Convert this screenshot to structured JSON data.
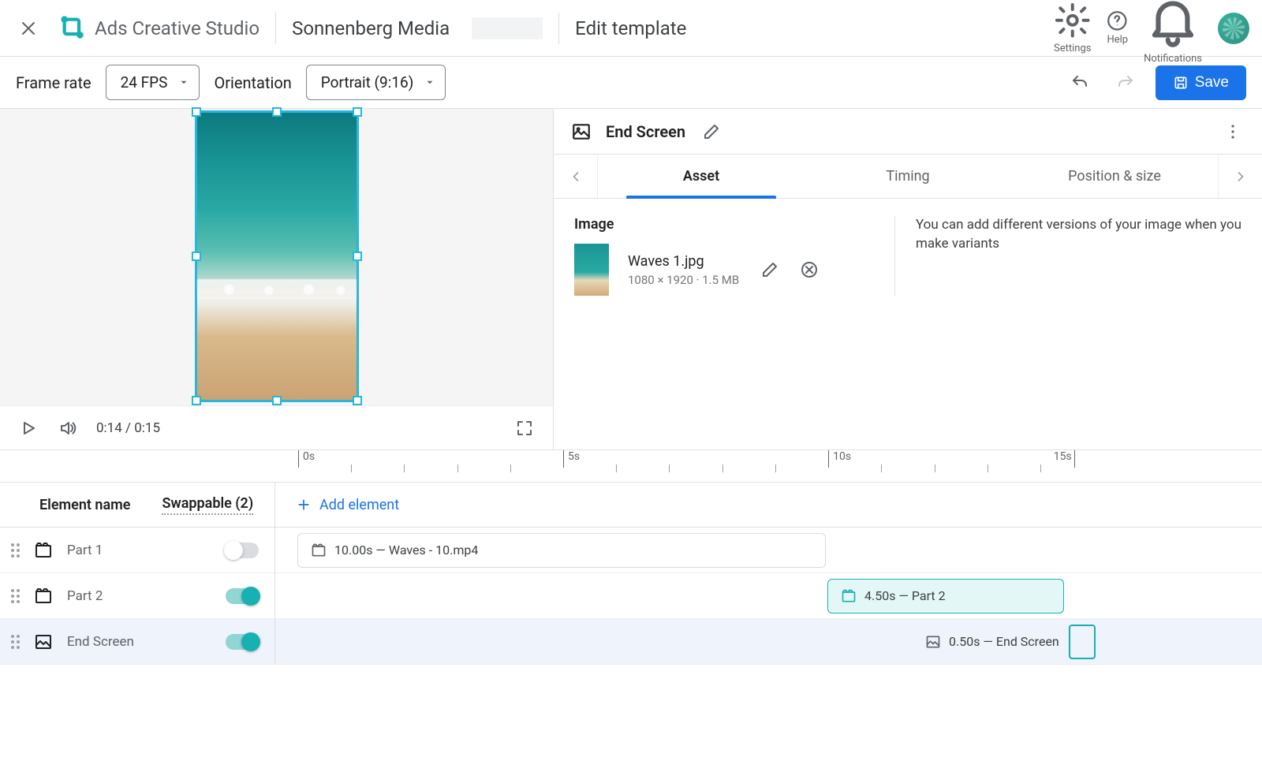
{
  "header": {
    "app_title": "Ads Creative Studio",
    "org": "Sonnenberg Media",
    "page": "Edit template",
    "actions": {
      "settings": "Settings",
      "help": "Help",
      "notifications": "Notifications"
    }
  },
  "toolbar": {
    "frame_rate_label": "Frame rate",
    "frame_rate_value": "24 FPS",
    "orientation_label": "Orientation",
    "orientation_value": "Portrait (9:16)",
    "save": "Save"
  },
  "player": {
    "time": "0:14 / 0:15"
  },
  "panel": {
    "title": "End Screen",
    "tabs": {
      "asset": "Asset",
      "timing": "Timing",
      "pos": "Position & size"
    },
    "image_section": "Image",
    "asset": {
      "name": "Waves 1.jpg",
      "meta": "1080 × 1920 · 1.5 MB"
    },
    "hint": "You can add different versions of your image when you make variants"
  },
  "ruler": {
    "t0": "0s",
    "t5": "5s",
    "t10": "10s",
    "t15": "15s"
  },
  "tracks_head": {
    "col1": "Element name",
    "col2": "Swappable (2)",
    "add": "Add element"
  },
  "tracks": [
    {
      "name": "Part 1",
      "swappable": false,
      "clip": "10.00s — Waves - 10.mp4",
      "type": "video"
    },
    {
      "name": "Part 2",
      "swappable": true,
      "clip": "4.50s — Part 2",
      "type": "video"
    },
    {
      "name": "End Screen",
      "swappable": true,
      "clip": "0.50s — End Screen",
      "type": "image"
    }
  ]
}
